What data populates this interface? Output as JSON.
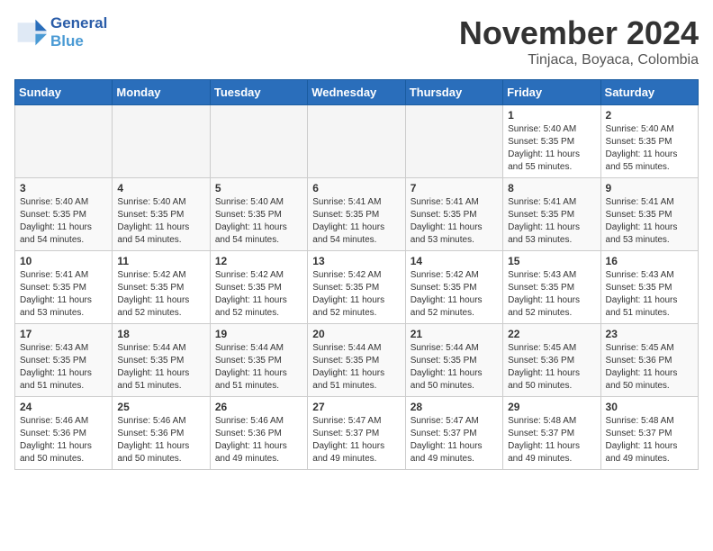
{
  "logo": {
    "line1": "General",
    "line2": "Blue"
  },
  "title": "November 2024",
  "subtitle": "Tinjaca, Boyaca, Colombia",
  "days_of_week": [
    "Sunday",
    "Monday",
    "Tuesday",
    "Wednesday",
    "Thursday",
    "Friday",
    "Saturday"
  ],
  "weeks": [
    [
      {
        "day": "",
        "info": ""
      },
      {
        "day": "",
        "info": ""
      },
      {
        "day": "",
        "info": ""
      },
      {
        "day": "",
        "info": ""
      },
      {
        "day": "",
        "info": ""
      },
      {
        "day": "1",
        "info": "Sunrise: 5:40 AM\nSunset: 5:35 PM\nDaylight: 11 hours\nand 55 minutes."
      },
      {
        "day": "2",
        "info": "Sunrise: 5:40 AM\nSunset: 5:35 PM\nDaylight: 11 hours\nand 55 minutes."
      }
    ],
    [
      {
        "day": "3",
        "info": "Sunrise: 5:40 AM\nSunset: 5:35 PM\nDaylight: 11 hours\nand 54 minutes."
      },
      {
        "day": "4",
        "info": "Sunrise: 5:40 AM\nSunset: 5:35 PM\nDaylight: 11 hours\nand 54 minutes."
      },
      {
        "day": "5",
        "info": "Sunrise: 5:40 AM\nSunset: 5:35 PM\nDaylight: 11 hours\nand 54 minutes."
      },
      {
        "day": "6",
        "info": "Sunrise: 5:41 AM\nSunset: 5:35 PM\nDaylight: 11 hours\nand 54 minutes."
      },
      {
        "day": "7",
        "info": "Sunrise: 5:41 AM\nSunset: 5:35 PM\nDaylight: 11 hours\nand 53 minutes."
      },
      {
        "day": "8",
        "info": "Sunrise: 5:41 AM\nSunset: 5:35 PM\nDaylight: 11 hours\nand 53 minutes."
      },
      {
        "day": "9",
        "info": "Sunrise: 5:41 AM\nSunset: 5:35 PM\nDaylight: 11 hours\nand 53 minutes."
      }
    ],
    [
      {
        "day": "10",
        "info": "Sunrise: 5:41 AM\nSunset: 5:35 PM\nDaylight: 11 hours\nand 53 minutes."
      },
      {
        "day": "11",
        "info": "Sunrise: 5:42 AM\nSunset: 5:35 PM\nDaylight: 11 hours\nand 52 minutes."
      },
      {
        "day": "12",
        "info": "Sunrise: 5:42 AM\nSunset: 5:35 PM\nDaylight: 11 hours\nand 52 minutes."
      },
      {
        "day": "13",
        "info": "Sunrise: 5:42 AM\nSunset: 5:35 PM\nDaylight: 11 hours\nand 52 minutes."
      },
      {
        "day": "14",
        "info": "Sunrise: 5:42 AM\nSunset: 5:35 PM\nDaylight: 11 hours\nand 52 minutes."
      },
      {
        "day": "15",
        "info": "Sunrise: 5:43 AM\nSunset: 5:35 PM\nDaylight: 11 hours\nand 52 minutes."
      },
      {
        "day": "16",
        "info": "Sunrise: 5:43 AM\nSunset: 5:35 PM\nDaylight: 11 hours\nand 51 minutes."
      }
    ],
    [
      {
        "day": "17",
        "info": "Sunrise: 5:43 AM\nSunset: 5:35 PM\nDaylight: 11 hours\nand 51 minutes."
      },
      {
        "day": "18",
        "info": "Sunrise: 5:44 AM\nSunset: 5:35 PM\nDaylight: 11 hours\nand 51 minutes."
      },
      {
        "day": "19",
        "info": "Sunrise: 5:44 AM\nSunset: 5:35 PM\nDaylight: 11 hours\nand 51 minutes."
      },
      {
        "day": "20",
        "info": "Sunrise: 5:44 AM\nSunset: 5:35 PM\nDaylight: 11 hours\nand 51 minutes."
      },
      {
        "day": "21",
        "info": "Sunrise: 5:44 AM\nSunset: 5:35 PM\nDaylight: 11 hours\nand 50 minutes."
      },
      {
        "day": "22",
        "info": "Sunrise: 5:45 AM\nSunset: 5:36 PM\nDaylight: 11 hours\nand 50 minutes."
      },
      {
        "day": "23",
        "info": "Sunrise: 5:45 AM\nSunset: 5:36 PM\nDaylight: 11 hours\nand 50 minutes."
      }
    ],
    [
      {
        "day": "24",
        "info": "Sunrise: 5:46 AM\nSunset: 5:36 PM\nDaylight: 11 hours\nand 50 minutes."
      },
      {
        "day": "25",
        "info": "Sunrise: 5:46 AM\nSunset: 5:36 PM\nDaylight: 11 hours\nand 50 minutes."
      },
      {
        "day": "26",
        "info": "Sunrise: 5:46 AM\nSunset: 5:36 PM\nDaylight: 11 hours\nand 49 minutes."
      },
      {
        "day": "27",
        "info": "Sunrise: 5:47 AM\nSunset: 5:37 PM\nDaylight: 11 hours\nand 49 minutes."
      },
      {
        "day": "28",
        "info": "Sunrise: 5:47 AM\nSunset: 5:37 PM\nDaylight: 11 hours\nand 49 minutes."
      },
      {
        "day": "29",
        "info": "Sunrise: 5:48 AM\nSunset: 5:37 PM\nDaylight: 11 hours\nand 49 minutes."
      },
      {
        "day": "30",
        "info": "Sunrise: 5:48 AM\nSunset: 5:37 PM\nDaylight: 11 hours\nand 49 minutes."
      }
    ]
  ]
}
